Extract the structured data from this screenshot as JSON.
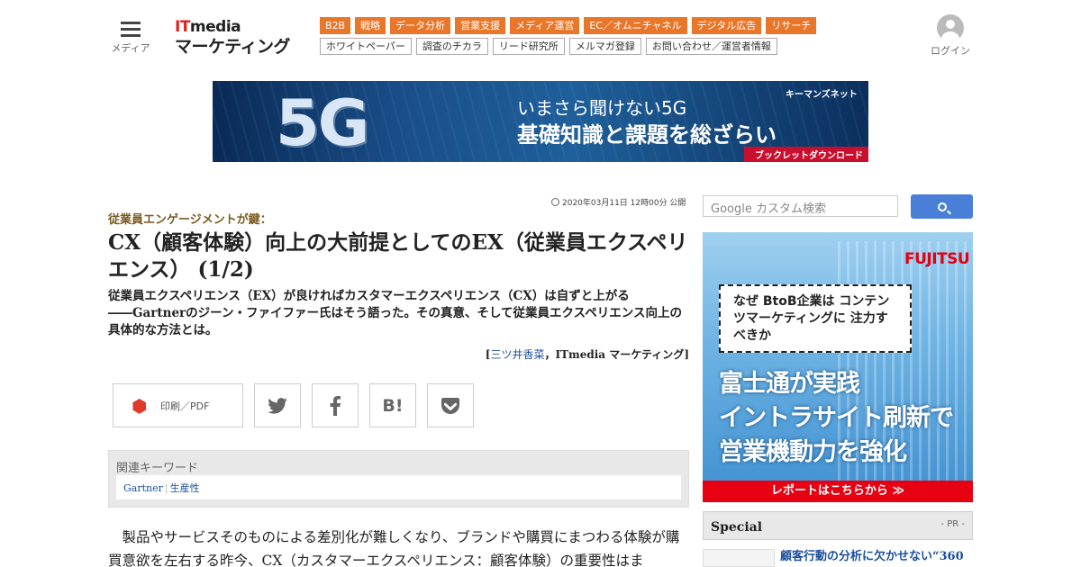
{
  "header": {
    "menu_label": "メディア",
    "logo_it": "IT",
    "logo_media": "media",
    "logo_marketing": "マーケティング",
    "tags_primary": [
      "B2B",
      "戦略",
      "データ分析",
      "営業支援",
      "メディア運営",
      "EC／オムニチャネル",
      "デジタル広告",
      "リサーチ"
    ],
    "tags_secondary": [
      "ホワイトペーパー",
      "調査のチカラ",
      "リード研究所",
      "メルマガ登録",
      "お問い合わせ／運営者情報"
    ],
    "login_label": "ログイン"
  },
  "banner": {
    "big": "5G",
    "line1": "いまさら聞けない5G",
    "line2": "基礎知識と課題を総ざらい",
    "brand": "キーマンズネット",
    "cta": "ブックレットダウンロード"
  },
  "article": {
    "date": "2020年03月11日 12時00分 公開",
    "subtitle": "従業員エンゲージメントが鍵：",
    "title": "CX（顧客体験）向上の大前提としてのEX（従業員エクスペリエンス） (1/2)",
    "lead": "従業員エクスペリエンス（EX）が良ければカスタマーエクスペリエンス（CX）は自ずと上がる――Gartnerのジーン・ファイファー氏はそう語った。その真意、そして従業員エクスペリエンス向上の具体的な方法とは。",
    "byline_open": "[",
    "author": "三ツ井香菜",
    "byline_sep": "，",
    "publication": "ITmedia マーケティング",
    "byline_close": "]",
    "share": {
      "print_label": "印刷／PDF",
      "twitter": "twitter-icon",
      "facebook": "facebook-icon",
      "hatena": "B!",
      "pocket": "pocket-icon"
    },
    "keywords_title": "関連キーワード",
    "keywords": [
      "Gartner",
      "生産性"
    ],
    "body": "製品やサービスそのものによる差別化が難しくなり、ブランドや購買にまつわる体験が購買意欲を左右する昨今、CX（カスタマーエクスペリエンス：顧客体験）の重要性はま"
  },
  "sidebar": {
    "search_placeholder": "Google カスタム検索",
    "ad": {
      "brand": "FUJITSU",
      "bubble": "なぜ BtoB企業は コンテンツマーケティングに 注力すべきか",
      "headline1": "富士通が実践",
      "headline2": "イントラサイト刷新で",
      "headline3": "営業機動力を強化",
      "cta": "レポートはこちらから ≫"
    },
    "special_title": "Special",
    "special_pr": "- PR -",
    "special_item": "顧客行動の分析に欠かせない“360"
  }
}
